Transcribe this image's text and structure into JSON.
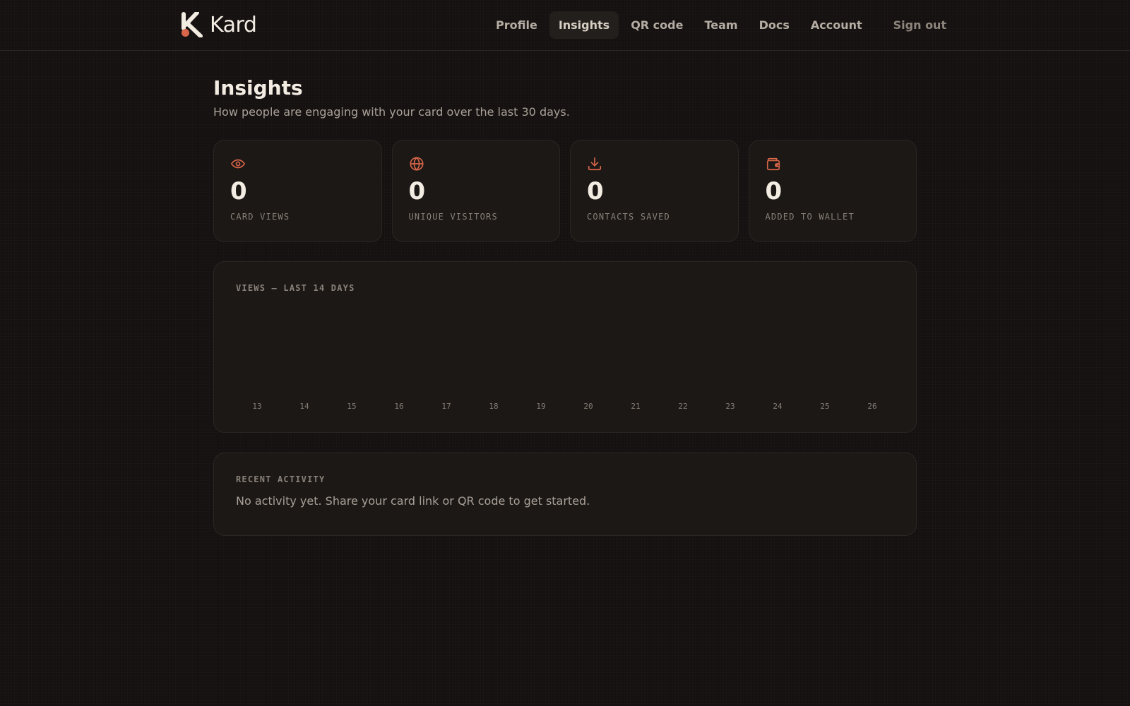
{
  "brand": {
    "name": "Kard",
    "accent": "#d9664a"
  },
  "nav": {
    "items": [
      {
        "label": "Profile",
        "active": false
      },
      {
        "label": "Insights",
        "active": true
      },
      {
        "label": "QR code",
        "active": false
      },
      {
        "label": "Team",
        "active": false
      },
      {
        "label": "Docs",
        "active": false
      },
      {
        "label": "Account",
        "active": false
      }
    ],
    "signout_label": "Sign out"
  },
  "page": {
    "title": "Insights",
    "subtitle": "How people are engaging with your card over the last 30 days."
  },
  "stats": [
    {
      "icon": "eye-icon",
      "value": "0",
      "label": "CARD VIEWS"
    },
    {
      "icon": "globe-icon",
      "value": "0",
      "label": "UNIQUE VISITORS"
    },
    {
      "icon": "download-icon",
      "value": "0",
      "label": "CONTACTS SAVED"
    },
    {
      "icon": "wallet-icon",
      "value": "0",
      "label": "ADDED TO WALLET"
    }
  ],
  "chart_panel": {
    "label": "VIEWS — LAST 14 DAYS"
  },
  "chart_data": {
    "type": "bar",
    "categories": [
      "13",
      "14",
      "15",
      "16",
      "17",
      "18",
      "19",
      "20",
      "21",
      "22",
      "23",
      "24",
      "25",
      "26"
    ],
    "values": [
      0,
      0,
      0,
      0,
      0,
      0,
      0,
      0,
      0,
      0,
      0,
      0,
      0,
      0
    ],
    "title": "VIEWS — LAST 14 DAYS",
    "xlabel": "",
    "ylabel": "",
    "grid": false
  },
  "activity": {
    "label": "RECENT ACTIVITY",
    "empty_text": "No activity yet. Share your card link or QR code to get started."
  }
}
